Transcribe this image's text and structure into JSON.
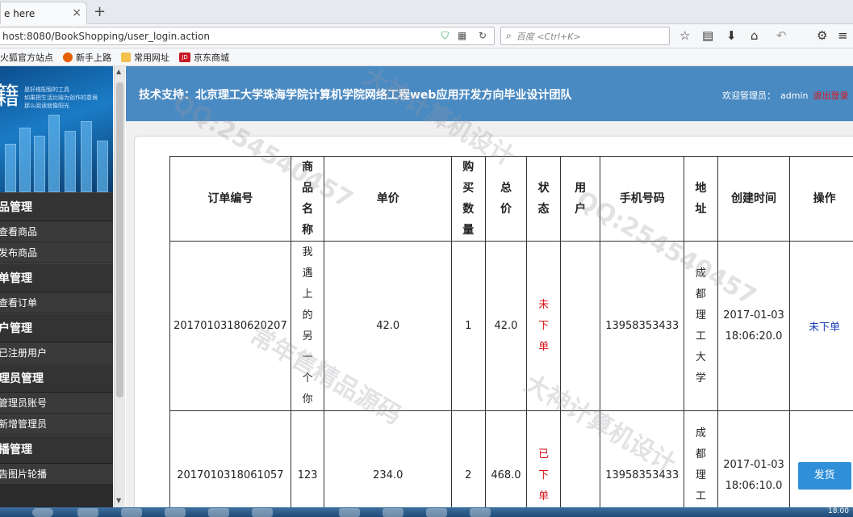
{
  "browser": {
    "tab_title": "e here",
    "tab_close": "×",
    "new_tab": "+",
    "url": "host:8080/BookShopping/user_login.action",
    "search_placeholder": "百度 <Ctrl+K>",
    "bookmarks": [
      {
        "label": "火狐官方站点",
        "color": "#e66000"
      },
      {
        "label": "新手上路",
        "color": "#e66000"
      },
      {
        "label": "常用网址",
        "color": "#f2c14e"
      },
      {
        "label": "京东商城",
        "color": "#c81623",
        "prefix": "JD"
      }
    ]
  },
  "sidebar": {
    "banner_char": "籍",
    "banner_lines": [
      "是好搭配智的工具",
      "如果把生活比喻为创作的意境",
      "那么阅读就像阳光"
    ],
    "groups": [
      {
        "title": "品管理",
        "items": [
          "查看商品",
          "发布商品"
        ]
      },
      {
        "title": "单管理",
        "items": [
          "查看订单"
        ]
      },
      {
        "title": "户管理",
        "items": [
          "已注册用户"
        ]
      },
      {
        "title": "理员管理",
        "items": [
          "管理员账号",
          "新增管理员"
        ]
      },
      {
        "title": "播管理",
        "items": [
          "告图片轮播"
        ]
      }
    ]
  },
  "header": {
    "title": "技术支持：北京理工大学珠海学院计算机学院网络工程web应用开发方向毕业设计团队",
    "welcome": "欢迎管理员：",
    "admin": "admin",
    "logout": "退出登录"
  },
  "table": {
    "headers": [
      "订单编号",
      "商品名称",
      "单价",
      "购买数量",
      "总价",
      "状态",
      "用户",
      "手机号码",
      "地址",
      "创建时间",
      "操作"
    ],
    "rows": [
      {
        "order_no": "20170103180620207",
        "product": "我遇上的另一个你",
        "price": "42.0",
        "qty": "1",
        "total": "42.0",
        "status": "未下单",
        "user": "",
        "phone": "13958353433",
        "address": "成都理工大学",
        "created": "2017-01-03 18:06:20.0",
        "action": "未下单"
      },
      {
        "order_no": "2017010318061057",
        "product": "123",
        "price": "234.0",
        "qty": "2",
        "total": "468.0",
        "status": "已下单",
        "user": "",
        "phone": "13958353433",
        "address": "成都理工大",
        "created": "2017-01-03 18:06:10.0",
        "action": "发货"
      }
    ]
  },
  "taskbar": {
    "clock": "18:00"
  },
  "watermarks": [
    "QQ:254540457",
    "大神计算机设计",
    "常年售精品源码"
  ]
}
